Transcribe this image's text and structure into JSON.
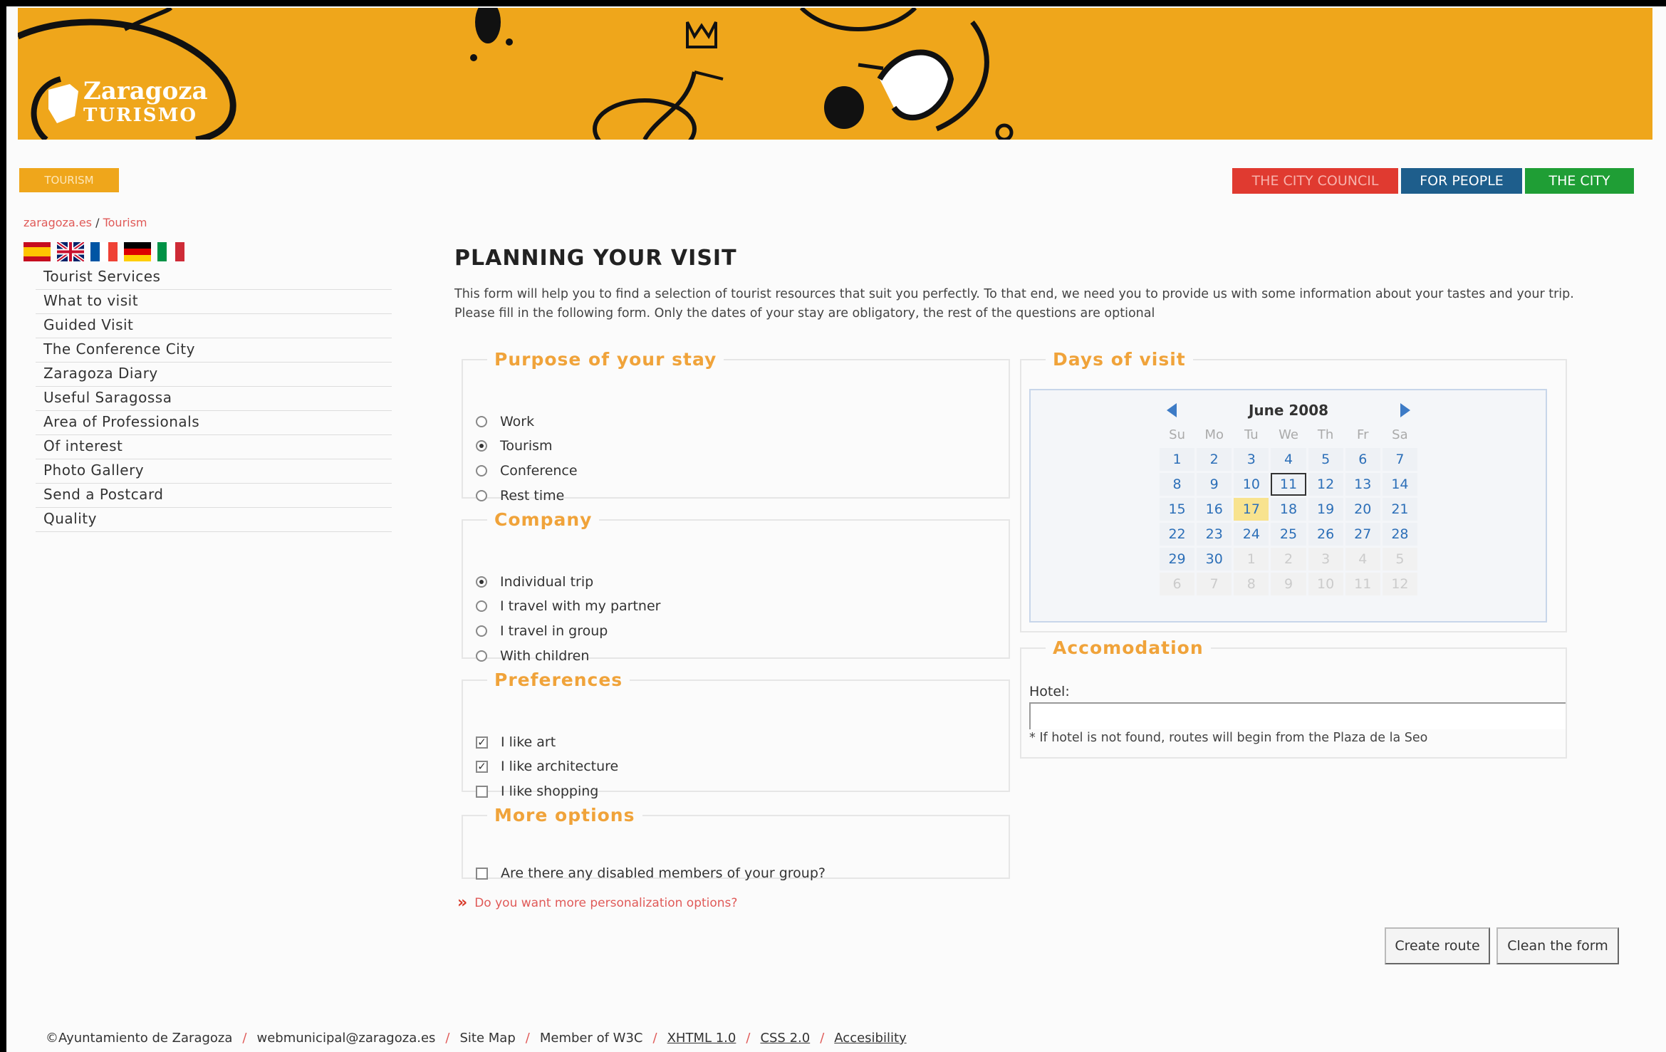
{
  "banner": {
    "logo_line1": "Zaragoza",
    "logo_line2": "TURISMO",
    "color": "#efa61b"
  },
  "header": {
    "tourism_button": "TOURISM",
    "nav": [
      {
        "label": "THE CITY COUNCIL",
        "color": "#e03a30"
      },
      {
        "label": "FOR PEOPLE",
        "color": "#1e5e8c"
      },
      {
        "label": "THE CITY",
        "color": "#1f9e35"
      }
    ]
  },
  "breadcrumb": {
    "home": "zaragoza.es",
    "separator": "/",
    "current": "Tourism"
  },
  "languages": [
    "es",
    "en",
    "fr",
    "de",
    "it"
  ],
  "sidebar": {
    "items": [
      "Tourist Services",
      "What to visit",
      "Guided Visit",
      "The Conference City",
      "Zaragoza Diary",
      "Useful Saragossa",
      "Area of Professionals",
      "Of interest",
      "Photo Gallery",
      "Send a Postcard",
      "Quality"
    ]
  },
  "main": {
    "title": "PLANNING YOUR VISIT",
    "intro": "This form will help you to find a selection of tourist resources that suit you perfectly. To that end, we need you to provide us with some information about your tastes and your trip. Please fill in the following form. Only the dates of your stay are obligatory, the rest of the questions are optional"
  },
  "purpose": {
    "legend": "Purpose of your stay",
    "options": [
      "Work",
      "Tourism",
      "Conference",
      "Rest time"
    ],
    "selected": "Tourism"
  },
  "company": {
    "legend": "Company",
    "options": [
      "Individual trip",
      "I travel with my partner",
      "I travel in group",
      "With children"
    ],
    "selected": "Individual trip"
  },
  "preferences": {
    "legend": "Preferences",
    "options": [
      {
        "label": "I like art",
        "checked": true
      },
      {
        "label": "I like architecture",
        "checked": true
      },
      {
        "label": "I like shopping",
        "checked": false
      }
    ]
  },
  "more_options": {
    "legend": "More options",
    "question": "Are there any disabled members of your group?",
    "checked": false
  },
  "more_link": "Do you want more personalization options?",
  "calendar": {
    "legend": "Days of visit",
    "month": "June 2008",
    "weekdays": [
      "Su",
      "Mo",
      "Tu",
      "We",
      "Th",
      "Fr",
      "Sa"
    ],
    "weeks": [
      [
        "1",
        "2",
        "3",
        "4",
        "5",
        "6",
        "7"
      ],
      [
        "8",
        "9",
        "10",
        "11",
        "12",
        "13",
        "14"
      ],
      [
        "15",
        "16",
        "17",
        "18",
        "19",
        "20",
        "21"
      ],
      [
        "22",
        "23",
        "24",
        "25",
        "26",
        "27",
        "28"
      ],
      [
        "29",
        "30",
        "1",
        "2",
        "3",
        "4",
        "5"
      ],
      [
        "6",
        "7",
        "8",
        "9",
        "10",
        "11",
        "12"
      ]
    ],
    "selected_day": "11",
    "today": "17"
  },
  "accommodation": {
    "legend": "Accomodation",
    "hotel_label": "Hotel:",
    "hotel_value": "",
    "note": "* If hotel is not found, routes will begin from the Plaza de la Seo"
  },
  "buttons": {
    "create": "Create route",
    "clean": "Clean the form"
  },
  "footer": {
    "items": [
      "©Ayuntamiento de Zaragoza",
      "webmunicipal@zaragoza.es",
      "Site Map",
      "Member of W3C",
      "XHTML 1.0",
      "CSS 2.0",
      "Accesibility"
    ]
  }
}
